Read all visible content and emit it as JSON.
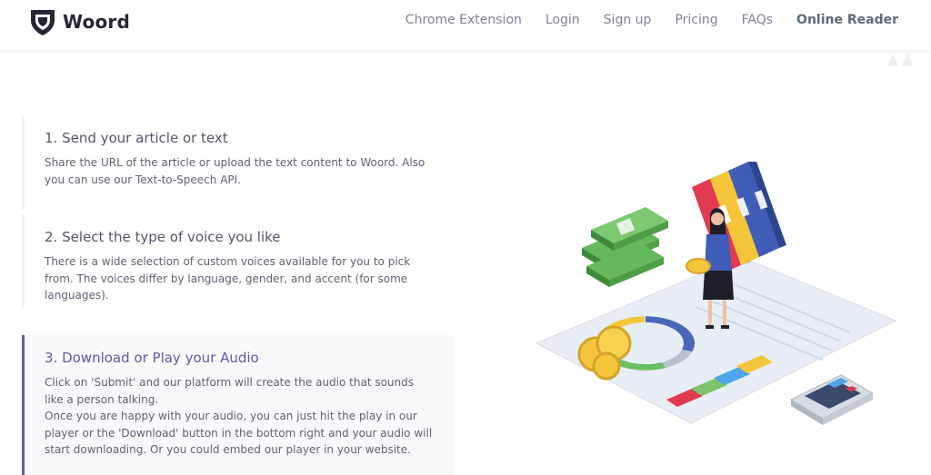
{
  "header": {
    "brand": "Woord",
    "nav": [
      {
        "label": "Chrome Extension"
      },
      {
        "label": "Login"
      },
      {
        "label": "Sign up"
      },
      {
        "label": "Pricing"
      },
      {
        "label": "FAQs"
      },
      {
        "label": "Online Reader"
      }
    ]
  },
  "steps": [
    {
      "title": "1. Send your article or text",
      "text": "Share the URL of the article or upload the text content to Woord. Also you can use our Text-to-Speech API."
    },
    {
      "title": "2. Select the type of voice you like",
      "text": "There is a wide selection of custom voices available for you to pick from. The voices differ by language, gender, and accent (for some languages)."
    },
    {
      "title": "3. Download or Play your Audio",
      "text": "Click on 'Submit' and our platform will create the audio that sounds like a person talking.",
      "text2": "Once you are happy with your audio, you can just hit the play in our player or the 'Download' button in the bottom right and your audio will start downloading. Or you could embed our player in your website."
    }
  ],
  "colors": {
    "accent": "#5c5fa9",
    "nav_text": "#7a8696",
    "title_text": "#4f5869"
  }
}
